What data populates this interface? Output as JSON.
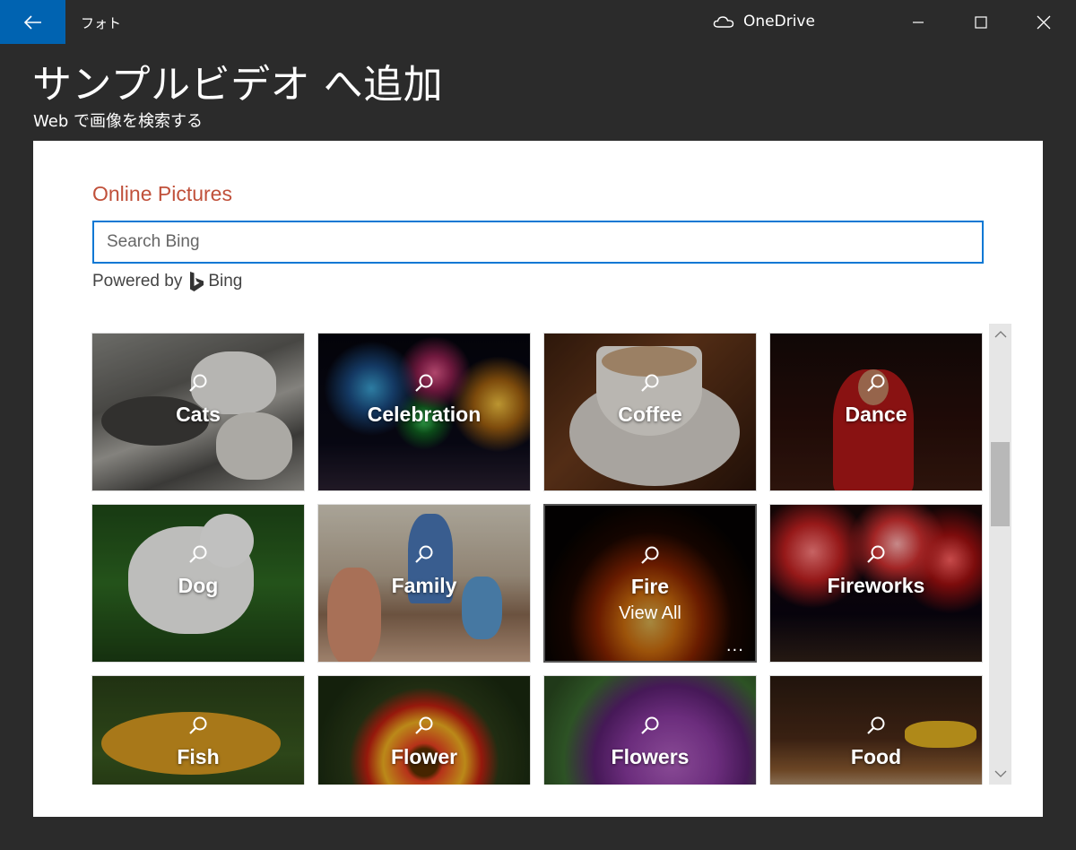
{
  "titlebar": {
    "app_name": "フォト",
    "service_name": "OneDrive"
  },
  "header": {
    "title": "サンプルビデオ へ追加",
    "subtitle": "Web で画像を検索する"
  },
  "dialog": {
    "title": "Online Pictures",
    "search_placeholder": "Search Bing",
    "powered_by": "Powered by",
    "provider": "Bing"
  },
  "categories": [
    {
      "label": "Cats"
    },
    {
      "label": "Celebration"
    },
    {
      "label": "Coffee"
    },
    {
      "label": "Dance"
    },
    {
      "label": "Dog"
    },
    {
      "label": "Family"
    },
    {
      "label": "Fire",
      "view_all": "View All",
      "more": "..."
    },
    {
      "label": "Fireworks"
    },
    {
      "label": "Fish"
    },
    {
      "label": "Flower"
    },
    {
      "label": "Flowers"
    },
    {
      "label": "Food"
    }
  ],
  "colors": {
    "accent": "#0063b1",
    "search_border": "#0a78d4",
    "dialog_title": "#c0503a",
    "window_bg": "#2b2b2b"
  }
}
